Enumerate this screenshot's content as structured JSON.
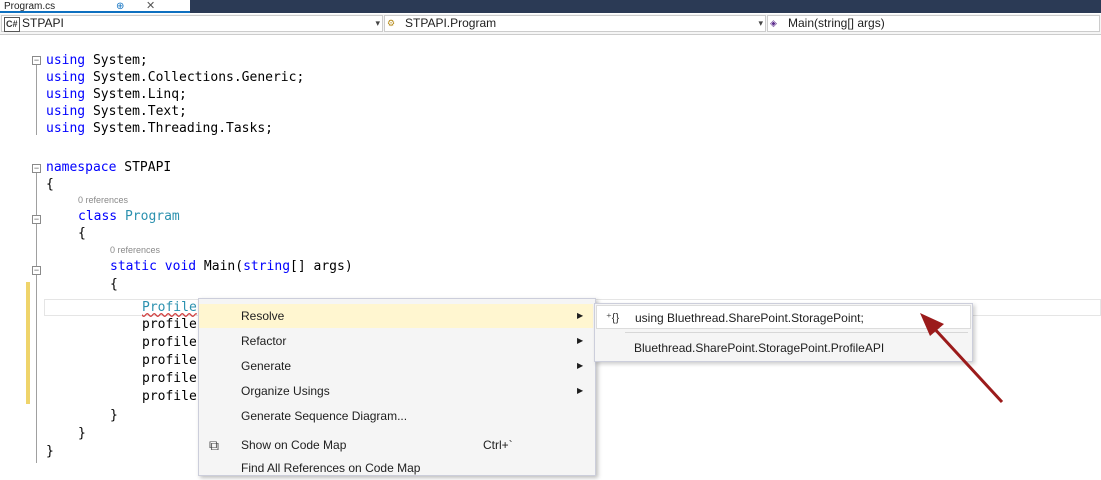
{
  "tab": {
    "title": "Program.cs",
    "pin": "⊕",
    "close": "✕"
  },
  "nav": {
    "project": {
      "icon": "C#",
      "label": "STPAPI"
    },
    "type": {
      "label": "STPAPI.Program"
    },
    "member": {
      "label": "Main(string[] args)"
    }
  },
  "code": {
    "l1": "using",
    "l1b": " System;",
    "l2": "using",
    "l2b": " System.Collections.Generic;",
    "l3": "using",
    "l3b": " System.Linq;",
    "l4": "using",
    "l4b": " System.Text;",
    "l5": "using",
    "l5b": " System.Threading.Tasks;",
    "ns_kw": "namespace",
    "ns_name": " STPAPI",
    "brace_open": "{",
    "refs1": "0 references",
    "class_kw": "class",
    "class_name": "Program",
    "brace_open2": "{",
    "refs2": "0 references",
    "m_kw1": "static",
    "m_kw2": "void",
    "m_rest": " Main(",
    "m_kw3": "string",
    "m_rest2": "[] args)",
    "brace_open3": "{",
    "p1": "Profile",
    "p2": "profile",
    "p3": "profile",
    "p4": "profile",
    "p5": "profile",
    "p6": "profile",
    "brace_close3": "}",
    "brace_close2": "}",
    "brace_close1": "}"
  },
  "context_menu": {
    "items": [
      {
        "label": "Resolve",
        "shortcut": "",
        "submenu": true
      },
      {
        "label": "Refactor",
        "shortcut": "",
        "submenu": true
      },
      {
        "label": "Generate",
        "shortcut": "",
        "submenu": true
      },
      {
        "label": "Organize Usings",
        "shortcut": "",
        "submenu": true
      },
      {
        "label": "Generate Sequence Diagram...",
        "shortcut": "",
        "submenu": false
      },
      {
        "label": "Show on Code Map",
        "shortcut": "Ctrl+`",
        "submenu": false
      },
      {
        "label": "Find All References on Code Map",
        "shortcut": "",
        "submenu": false
      }
    ],
    "arrow": "▶",
    "codemap_icon": "code-map-icon"
  },
  "resolve_submenu": {
    "items": [
      {
        "label": "using Bluethread.SharePoint.StoragePoint;"
      },
      {
        "label": "Bluethread.SharePoint.StoragePoint.ProfileAPI"
      }
    ],
    "using_icon": "⁺{}"
  },
  "colors": {
    "keyword": "#0000ff",
    "type": "#2b91af",
    "highlight": "#fff6d0",
    "annotation_arrow": "#9b1b1b"
  }
}
